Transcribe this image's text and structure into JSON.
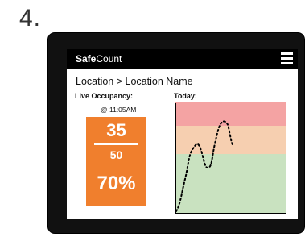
{
  "step_label": "4.",
  "app": {
    "title_bold": "Safe",
    "title_rest": "Count",
    "menu_icon": "hamburger-menu-icon"
  },
  "breadcrumb": "Location > Location Name",
  "occupancy": {
    "heading": "Live Occupancy:",
    "timestamp": "@ 11:05AM",
    "current": "35",
    "max": "50",
    "percent": "70%"
  },
  "today": {
    "heading": "Today:"
  },
  "colors": {
    "card": "#f07f2d",
    "zone_high": "#f4a3a3",
    "zone_mid": "#f6cfb0",
    "zone_low": "#c9e2c0",
    "header": "#000000",
    "sensor": "#2cc8b0"
  }
}
